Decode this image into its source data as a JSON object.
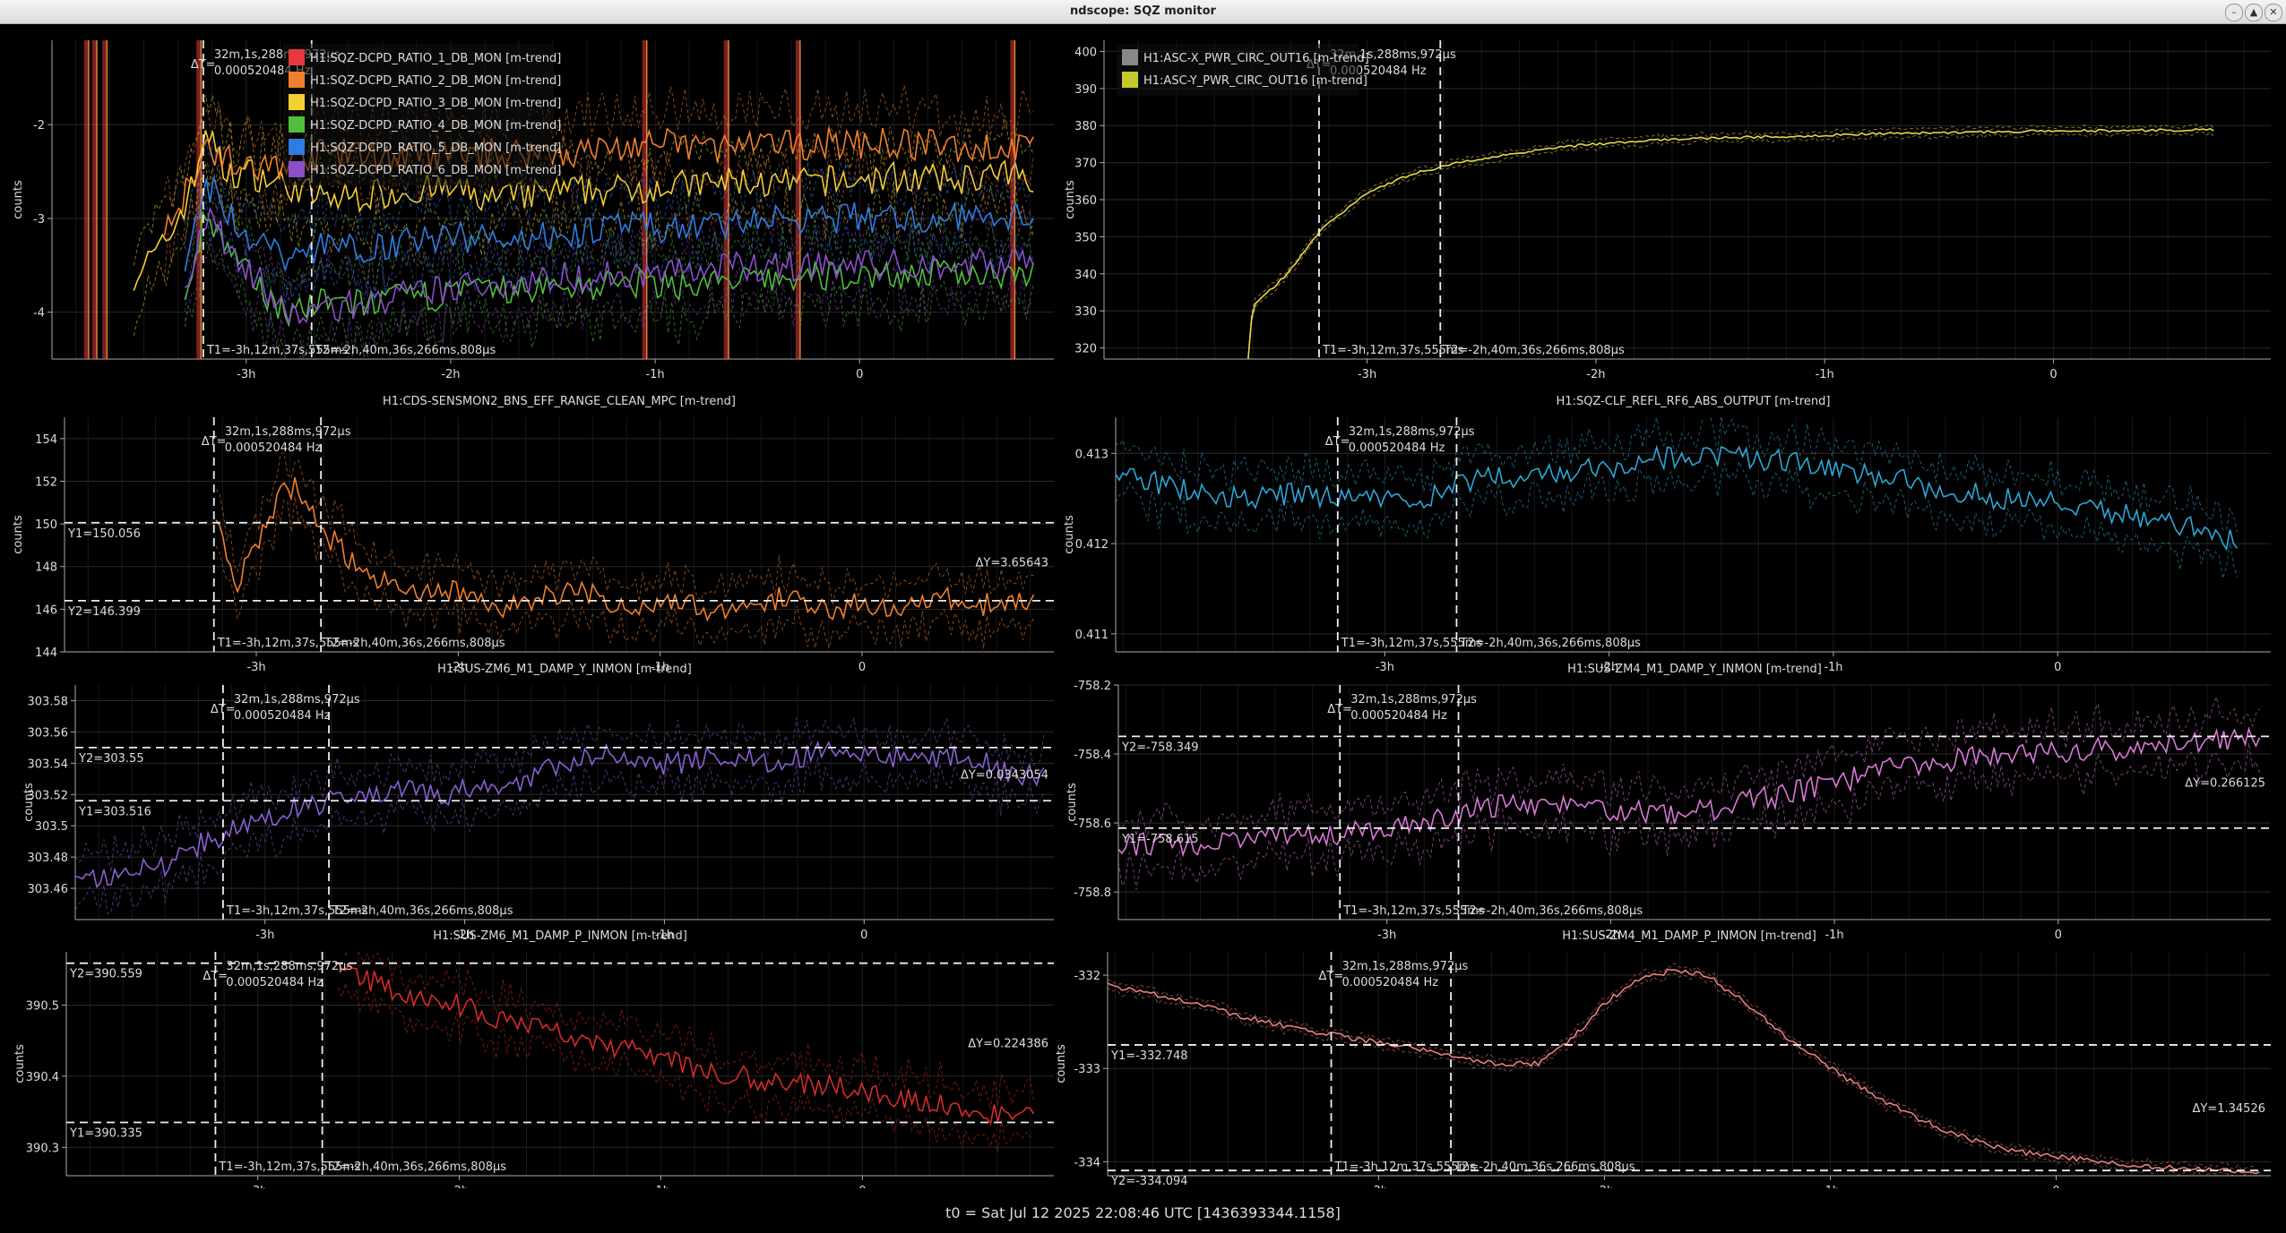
{
  "window": {
    "title": "ndscope: SQZ monitor",
    "buttons": [
      "minimize-icon",
      "maximize-icon",
      "close-icon"
    ]
  },
  "footer": {
    "t0": "t0 = Sat Jul 12 2025 22:08:46 UTC [1436393344.1158]"
  },
  "cursors": {
    "t1": "T1=-3h,12m,37s,555ms",
    "t2": "T2=-2h,40m,36s,266ms,808μs",
    "dt_label": "ΔT=",
    "dt": "32m,1s,288ms,972μs",
    "freq": "0.000520484 Hz",
    "t1_hours": -3.21,
    "t2_hours": -2.68
  },
  "chart_data": [
    {
      "id": "p1",
      "type": "line",
      "title": "",
      "ylabel": "counts",
      "xlim": [
        -3.95,
        0.95
      ],
      "ylim": [
        -4.5,
        -1.1
      ],
      "yticks": [
        -4,
        -3,
        -2
      ],
      "ytick_labels": [
        "-4",
        "-3",
        "-2"
      ],
      "xticks": [
        -3,
        -2,
        -1,
        0
      ],
      "xtick_labels": [
        "-3h",
        "-2h",
        "-1h",
        "0"
      ],
      "legend": {
        "placement": "top-left",
        "items": [
          {
            "name": "H1:SQZ-DCPD_RATIO_1_DB_MON [m-trend]",
            "color": "#e8383d"
          },
          {
            "name": "H1:SQZ-DCPD_RATIO_2_DB_MON [m-trend]",
            "color": "#f07f2c"
          },
          {
            "name": "H1:SQZ-DCPD_RATIO_3_DB_MON [m-trend]",
            "color": "#f5d033"
          },
          {
            "name": "H1:SQZ-DCPD_RATIO_4_DB_MON [m-trend]",
            "color": "#4fc03a"
          },
          {
            "name": "H1:SQZ-DCPD_RATIO_5_DB_MON [m-trend]",
            "color": "#2f7de0"
          },
          {
            "name": "H1:SQZ-DCPD_RATIO_6_DB_MON [m-trend]",
            "color": "#8a4fc9"
          }
        ]
      },
      "series": [
        {
          "name": "H1:SQZ-DCPD_RATIO_3_DB_MON [m-trend]",
          "color": "#f5d033",
          "x": [
            -3.55,
            -3.4,
            -3.25,
            -3.2,
            -3.1,
            -3.0,
            -2.8,
            -2.6,
            -2.4,
            -2.2,
            -2.0,
            -1.8,
            -1.6,
            -1.4,
            -1.2,
            -1.0,
            -0.8,
            -0.6,
            -0.4,
            -0.2,
            0.0,
            0.2,
            0.4,
            0.6,
            0.85
          ],
          "y": [
            -3.6,
            -3.3,
            -2.6,
            -2.0,
            -2.55,
            -2.5,
            -2.65,
            -2.8,
            -2.75,
            -2.7,
            -2.7,
            -2.8,
            -2.75,
            -2.7,
            -2.7,
            -2.65,
            -2.65,
            -2.6,
            -2.65,
            -2.6,
            -2.6,
            -2.55,
            -2.6,
            -2.55,
            -2.55
          ]
        },
        {
          "name": "H1:SQZ-DCPD_RATIO_2_DB_MON [m-trend]",
          "color": "#f07f2c",
          "x": [
            -3.4,
            -3.2,
            -3.0,
            -2.8,
            -2.6,
            -2.2,
            -1.8,
            -1.4,
            -1.0,
            -0.6,
            -0.2,
            0.2,
            0.6,
            0.85
          ],
          "y": [
            -3.2,
            -2.2,
            -2.5,
            -2.4,
            -2.3,
            -2.35,
            -2.3,
            -2.3,
            -2.2,
            -2.25,
            -2.2,
            -2.2,
            -2.25,
            -2.25
          ]
        },
        {
          "name": "H1:SQZ-DCPD_RATIO_4_DB_MON [m-trend]",
          "color": "#4fc03a",
          "x": [
            -3.3,
            -3.2,
            -3.0,
            -2.8,
            -2.6,
            -2.4,
            -2.0,
            -1.6,
            -1.2,
            -0.8,
            -0.4,
            0.0,
            0.4,
            0.85
          ],
          "y": [
            -3.8,
            -3.0,
            -3.6,
            -4.0,
            -3.9,
            -3.9,
            -3.8,
            -3.75,
            -3.7,
            -3.7,
            -3.65,
            -3.6,
            -3.6,
            -3.55
          ]
        },
        {
          "name": "H1:SQZ-DCPD_RATIO_6_DB_MON [m-trend]",
          "color": "#8a4fc9",
          "x": [
            -3.3,
            -3.2,
            -3.0,
            -2.8,
            -2.6,
            -2.4,
            -2.0,
            -1.6,
            -1.2,
            -0.8,
            -0.4,
            0.0,
            0.4,
            0.85
          ],
          "y": [
            -3.7,
            -3.0,
            -3.5,
            -4.05,
            -3.95,
            -3.9,
            -3.75,
            -3.65,
            -3.6,
            -3.55,
            -3.5,
            -3.5,
            -3.5,
            -3.45
          ]
        },
        {
          "name": "H1:SQZ-DCPD_RATIO_5_DB_MON [m-trend]",
          "color": "#2f7de0",
          "x": [
            -3.3,
            -3.2,
            -3.0,
            -2.8,
            -2.6,
            -2.4,
            -2.0,
            -1.6,
            -1.2,
            -0.8,
            -0.4,
            0.0,
            0.4,
            0.85
          ],
          "y": [
            -3.4,
            -2.6,
            -3.2,
            -3.4,
            -3.3,
            -3.3,
            -3.2,
            -3.2,
            -3.1,
            -3.1,
            -3.0,
            -3.0,
            -3.0,
            -2.95
          ]
        }
      ],
      "glitches_x": [
        -3.78,
        -3.74,
        -3.69,
        -3.23,
        -1.05,
        -0.65,
        -0.3,
        0.75
      ]
    },
    {
      "id": "p2",
      "type": "line",
      "title": "",
      "ylabel": "counts",
      "xlim": [
        -4.15,
        0.95
      ],
      "ylim": [
        317,
        403
      ],
      "yticks": [
        320,
        330,
        340,
        350,
        360,
        370,
        380,
        390,
        400
      ],
      "ytick_labels": [
        "320",
        "330",
        "340",
        "350",
        "360",
        "370",
        "380",
        "390",
        "400"
      ],
      "xticks": [
        -3,
        -2,
        -1,
        0
      ],
      "xtick_labels": [
        "-3h",
        "-2h",
        "-1h",
        "0"
      ],
      "legend": {
        "placement": "top-left",
        "items": [
          {
            "name": "H1:ASC-X_PWR_CIRC_OUT16 [m-trend]",
            "color": "#888888"
          },
          {
            "name": "H1:ASC-Y_PWR_CIRC_OUT16 [m-trend]",
            "color": "#c8c82a"
          }
        ]
      },
      "series": [
        {
          "name": "H1:ASC-Y_PWR_CIRC_OUT16 [m-trend]",
          "color": "#e6d84a",
          "x": [
            -3.52,
            -3.5,
            -3.35,
            -3.2,
            -3.0,
            -2.8,
            -2.6,
            -2.4,
            -2.2,
            -2.0,
            -1.6,
            -1.2,
            -0.8,
            -0.4,
            0.0,
            0.4,
            0.7
          ],
          "y": [
            317,
            331,
            340,
            352,
            362,
            367,
            370,
            372,
            374,
            375,
            376.5,
            377,
            377.8,
            378.2,
            378.5,
            378.7,
            378.8
          ]
        }
      ]
    },
    {
      "id": "p3",
      "type": "line",
      "title": "H1:CDS-SENSMON2_BNS_EFF_RANGE_CLEAN_MPC [m-trend]",
      "ylabel": "counts",
      "xlim": [
        -3.95,
        0.95
      ],
      "ylim": [
        144,
        155
      ],
      "yticks": [
        144,
        146,
        148,
        150,
        152,
        154
      ],
      "ytick_labels": [
        "144",
        "146",
        "148",
        "150",
        "152",
        "154"
      ],
      "xticks": [
        -3,
        -2,
        -1,
        0
      ],
      "xtick_labels": [
        "-3h",
        "-2h",
        "-1h",
        "0"
      ],
      "ycursors": {
        "y1": 150.056,
        "y2": 146.399,
        "y1_label": "Y1=150.056",
        "y2_label": "Y2=146.399",
        "dy_label": "ΔY=3.65643"
      },
      "series": [
        {
          "name": "H1:CDS-SENSMON2_BNS_EFF_RANGE_CLEAN_MPC [m-trend]",
          "color": "#f07f2c",
          "x": [
            -3.2,
            -3.1,
            -3.0,
            -2.9,
            -2.8,
            -2.7,
            -2.6,
            -2.5,
            -2.4,
            -2.2,
            -2.0,
            -1.8,
            -1.6,
            -1.4,
            -1.2,
            -1.0,
            -0.8,
            -0.6,
            -0.4,
            -0.2,
            0.0,
            0.2,
            0.4,
            0.6,
            0.85
          ],
          "y": [
            150,
            147,
            149,
            151,
            152,
            150,
            149,
            148,
            147.5,
            146.5,
            147,
            146,
            146.5,
            147,
            146,
            146.5,
            146,
            146.2,
            146.5,
            146,
            146.3,
            146,
            146.5,
            146.2,
            146.4
          ]
        }
      ]
    },
    {
      "id": "p4",
      "type": "line",
      "title": "H1:SQZ-CLF_REFL_RF6_ABS_OUTPUT [m-trend]",
      "ylabel": "counts",
      "xlim": [
        -4.2,
        0.95
      ],
      "ylim": [
        410.8,
        413.4
      ],
      "yticks": [
        411,
        412,
        413
      ],
      "ytick_labels": [
        "0.411",
        "0.412",
        "0.413"
      ],
      "xticks": [
        -3,
        -2,
        -1,
        0
      ],
      "xtick_labels": [
        "-3h",
        "-2h",
        "-1h",
        "0"
      ],
      "series": [
        {
          "name": "H1:SQZ-CLF_REFL_RF6_ABS_OUTPUT [m-trend]",
          "color": "#2aa8d8",
          "x": [
            -4.2,
            -3.9,
            -3.6,
            -3.4,
            -3.2,
            -3.0,
            -2.8,
            -2.6,
            -2.4,
            -2.2,
            -2.0,
            -1.8,
            -1.6,
            -1.4,
            -1.2,
            -1.0,
            -0.8,
            -0.6,
            -0.4,
            -0.2,
            0.0,
            0.2,
            0.4,
            0.6,
            0.8
          ],
          "y": [
            412.8,
            412.6,
            412.5,
            412.55,
            412.5,
            412.5,
            412.5,
            412.7,
            412.75,
            412.8,
            412.85,
            412.95,
            413.0,
            412.95,
            412.9,
            412.85,
            412.75,
            412.65,
            412.55,
            412.5,
            412.45,
            412.35,
            412.3,
            412.2,
            412.0
          ]
        }
      ]
    },
    {
      "id": "p5",
      "type": "line",
      "title": "H1:SUS-ZM6_M1_DAMP_Y_INMON [m-trend]",
      "ylabel": "counts",
      "xlim": [
        -3.95,
        0.95
      ],
      "ylim": [
        303.44,
        303.59
      ],
      "yticks": [
        303.46,
        303.48,
        303.5,
        303.52,
        303.54,
        303.56,
        303.58
      ],
      "ytick_labels": [
        "303.46",
        "303.48",
        "303.5",
        "303.52",
        "303.54",
        "303.56",
        "303.58"
      ],
      "xticks": [
        -3,
        -2,
        -1,
        0
      ],
      "xtick_labels": [
        "-3h",
        "-2h",
        "-1h",
        "0"
      ],
      "ycursors": {
        "y1": 303.516,
        "y2": 303.55,
        "y1_label": "Y1=303.516",
        "y2_label": "Y2=303.55",
        "dy_label": "ΔY=0.0343054"
      },
      "series": [
        {
          "name": "H1:SUS-ZM6_M1_DAMP_Y_INMON [m-trend]",
          "color": "#8a5fd0",
          "x": [
            -3.95,
            -3.7,
            -3.5,
            -3.3,
            -3.1,
            -2.9,
            -2.7,
            -2.5,
            -2.3,
            -2.1,
            -1.9,
            -1.7,
            -1.5,
            -1.3,
            -1.1,
            -0.9,
            -0.7,
            -0.5,
            -0.3,
            -0.1,
            0.1,
            0.3,
            0.5,
            0.7,
            0.9
          ],
          "y": [
            303.465,
            303.47,
            303.475,
            303.49,
            303.5,
            303.51,
            303.515,
            303.52,
            303.525,
            303.52,
            303.525,
            303.53,
            303.54,
            303.545,
            303.54,
            303.54,
            303.545,
            303.54,
            303.545,
            303.55,
            303.545,
            303.54,
            303.545,
            303.535,
            303.53
          ]
        }
      ]
    },
    {
      "id": "p6",
      "type": "line",
      "title": "H1:SUS-ZM4_M1_DAMP_Y_INMON [m-trend]",
      "ylabel": "counts",
      "xlim": [
        -4.2,
        0.95
      ],
      "ylim": [
        -758.88,
        -758.2
      ],
      "yticks": [
        -758.8,
        -758.6,
        -758.4,
        -758.2
      ],
      "ytick_labels": [
        "-758.8",
        "-758.6",
        "-758.4",
        "-758.2"
      ],
      "xticks": [
        -3,
        -2,
        -1,
        0
      ],
      "xtick_labels": [
        "-3h",
        "-2h",
        "-1h",
        "0"
      ],
      "ycursors": {
        "y1": -758.615,
        "y2": -758.349,
        "y1_label": "Y1=-758.615",
        "y2_label": "Y2=-758.349",
        "dy_label": "ΔY=0.266125"
      },
      "series": [
        {
          "name": "H1:SUS-ZM4_M1_DAMP_Y_INMON [m-trend]",
          "color": "#d878d8",
          "x": [
            -4.2,
            -3.8,
            -3.5,
            -3.2,
            -2.9,
            -2.6,
            -2.3,
            -2.0,
            -1.7,
            -1.4,
            -1.1,
            -0.8,
            -0.5,
            -0.2,
            0.1,
            0.4,
            0.7,
            0.9
          ],
          "y": [
            -758.66,
            -758.66,
            -758.64,
            -758.63,
            -758.6,
            -758.56,
            -758.54,
            -758.56,
            -758.58,
            -758.54,
            -758.5,
            -758.45,
            -758.42,
            -758.4,
            -758.39,
            -758.38,
            -758.36,
            -758.35
          ]
        }
      ]
    },
    {
      "id": "p7",
      "type": "line",
      "title": "H1:SUS-ZM6_M1_DAMP_P_INMON [m-trend]",
      "ylabel": "counts",
      "xlim": [
        -3.95,
        0.95
      ],
      "ylim": [
        390.26,
        390.575
      ],
      "yticks": [
        390.3,
        390.4,
        390.5
      ],
      "ytick_labels": [
        "390.3",
        "390.4",
        "390.5"
      ],
      "xticks": [
        -3,
        -2,
        -1,
        0
      ],
      "xtick_labels": [
        "-3h",
        "-2h",
        "-1h",
        "0"
      ],
      "ycursors": {
        "y1": 390.335,
        "y2": 390.559,
        "y1_label": "Y1=390.335",
        "y2_label": "Y2=390.559",
        "dy_label": "ΔY=0.224386"
      },
      "series": [
        {
          "name": "H1:SUS-ZM6_M1_DAMP_P_INMON [m-trend]",
          "color": "#d82a2a",
          "x": [
            -2.6,
            -2.4,
            -2.2,
            -2.0,
            -1.8,
            -1.6,
            -1.4,
            -1.2,
            -1.0,
            -0.8,
            -0.6,
            -0.4,
            -0.2,
            0.0,
            0.2,
            0.4,
            0.6,
            0.85
          ],
          "y": [
            390.55,
            390.53,
            390.51,
            390.5,
            390.48,
            390.47,
            390.45,
            390.44,
            390.43,
            390.41,
            390.4,
            390.39,
            390.39,
            390.38,
            390.37,
            390.36,
            390.35,
            390.34
          ]
        }
      ]
    },
    {
      "id": "p8",
      "type": "line",
      "title": "H1:SUS-ZM4_M1_DAMP_P_INMON [m-trend]",
      "ylabel": "counts",
      "xlim": [
        -4.2,
        0.95
      ],
      "ylim": [
        -334.15,
        -331.75
      ],
      "yticks": [
        -334,
        -333,
        -332
      ],
      "ytick_labels": [
        "-334",
        "-333",
        "-332"
      ],
      "xticks": [
        -3,
        -2,
        -1,
        0
      ],
      "xtick_labels": [
        "-3h",
        "-2h",
        "-1h",
        "0"
      ],
      "ycursors": {
        "y1": -332.748,
        "y2": -334.094,
        "y1_label": "Y1=-332.748",
        "y2_label": "Y2=-334.094",
        "dy_label": "ΔY=1.34526"
      },
      "series": [
        {
          "name": "H1:SUS-ZM4_M1_DAMP_P_INMON [m-trend]",
          "color": "#e88080",
          "x": [
            -4.2,
            -3.9,
            -3.6,
            -3.3,
            -3.0,
            -2.7,
            -2.5,
            -2.3,
            -2.15,
            -2.0,
            -1.85,
            -1.7,
            -1.55,
            -1.4,
            -1.2,
            -1.0,
            -0.8,
            -0.6,
            -0.4,
            -0.2,
            0.0,
            0.2,
            0.4,
            0.6,
            0.9
          ],
          "y": [
            -332.1,
            -332.25,
            -332.45,
            -332.6,
            -332.72,
            -332.85,
            -332.95,
            -332.95,
            -332.7,
            -332.3,
            -332.05,
            -331.95,
            -332.0,
            -332.25,
            -332.65,
            -333.0,
            -333.3,
            -333.55,
            -333.75,
            -333.88,
            -333.95,
            -334.0,
            -334.05,
            -334.08,
            -334.1
          ]
        }
      ]
    }
  ]
}
